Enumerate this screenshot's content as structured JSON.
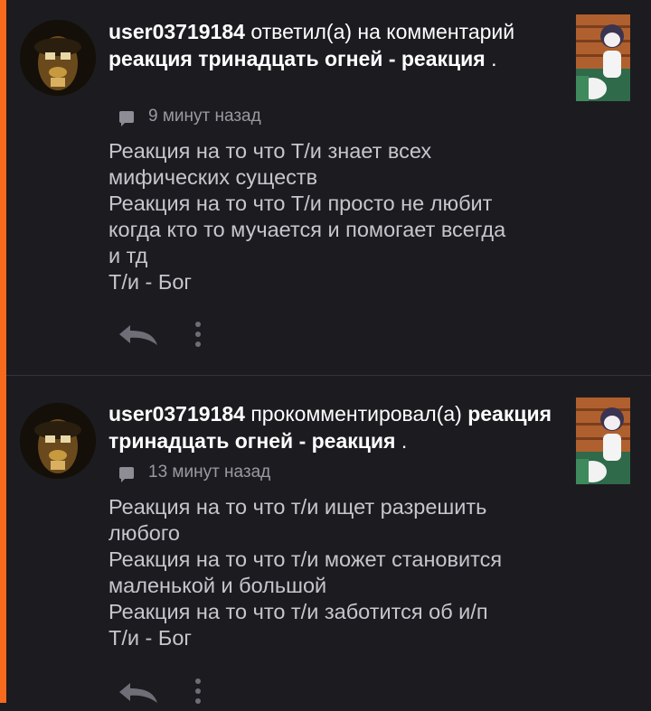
{
  "feed": {
    "items": [
      {
        "username": "user03719184",
        "action_text": "ответил(а) на комментарий",
        "target_title": "реакция тринадцать огней - реакция",
        "trailing": ".",
        "time_ago": "9 минут назад",
        "comment_lines": [
          "Реакция на то что Т/и знает всех",
          "мифических существ",
          "Реакция на то что Т/и просто не любит",
          "когда кто то мучается и помогает всегда",
          "и тд",
          "Т/и - Бог"
        ]
      },
      {
        "username": "user03719184",
        "action_text": "прокомментировал(а)",
        "target_title": "реакция тринадцать огней - реакция",
        "trailing": ".",
        "time_ago": "13 минут назад",
        "comment_lines": [
          "Реакция на то что т/и ищет разрешить",
          "любого",
          "Реакция на то что т/и может становится",
          "маленькой и большой",
          "Реакция на то что т/и заботится об и/п",
          "Т/и - Бог"
        ]
      }
    ]
  },
  "colors": {
    "accent": "#f56a1d",
    "background": "#1c1b20",
    "text_primary": "#ffffff",
    "text_secondary": "#c7c6cc",
    "text_meta": "#9a99a2"
  },
  "icons": [
    "avatar",
    "story-thumbnail",
    "comment-bubble-icon",
    "reply-icon",
    "more-vertical-icon"
  ]
}
